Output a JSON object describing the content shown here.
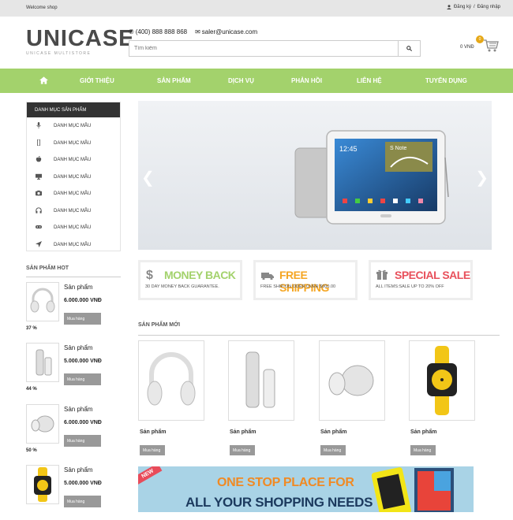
{
  "topbar": {
    "welcome": "Welcome shop",
    "register": "Đăng ký",
    "separator": "/",
    "login": "Đăng nhập"
  },
  "header": {
    "logo": "UNICASE",
    "tagline": "UNICASE MULTISTORE",
    "phone": "(400) 888 888 868",
    "email": "saler@unicase.com",
    "search_placeholder": "Tìm kiếm",
    "cart_amount": "0 VNĐ",
    "cart_count": "0"
  },
  "nav": {
    "items": [
      "GIỚI THIỆU",
      "SẢN PHẨM",
      "DỊCH VỤ",
      "PHẢN HỒI",
      "LIÊN HỆ",
      "TUYỂN DỤNG"
    ]
  },
  "sidebar": {
    "title": "DANH MỤC SẢN PHẨM",
    "categories": [
      {
        "label": "DANH MỤC MẪU",
        "icon": "microphone-icon"
      },
      {
        "label": "DANH MỤC MẪU",
        "icon": "mobile-icon"
      },
      {
        "label": "DANH MỤC MẪU",
        "icon": "apple-icon"
      },
      {
        "label": "DANH MỤC MẪU",
        "icon": "monitor-icon"
      },
      {
        "label": "DANH MỤC MẪU",
        "icon": "camera-icon"
      },
      {
        "label": "DANH MỤC MẪU",
        "icon": "headphones-icon"
      },
      {
        "label": "DANH MỤC MẪU",
        "icon": "gamepad-icon"
      },
      {
        "label": "DANH MỤC MẪU",
        "icon": "location-arrow-icon"
      }
    ]
  },
  "hot": {
    "title": "SẢN PHẨM HOT",
    "items": [
      {
        "name": "Sản phẩm",
        "price": "6.000.000 VNĐ",
        "buy": "Mua hàng",
        "percent": "37 %"
      },
      {
        "name": "Sản phẩm",
        "price": "5.000.000 VNĐ",
        "buy": "Mua hàng",
        "percent": "44 %"
      },
      {
        "name": "Sản phẩm",
        "price": "6.000.000 VNĐ",
        "buy": "Mua hàng",
        "percent": "50 %"
      },
      {
        "name": "Sản phẩm",
        "price": "5.000.000 VNĐ",
        "buy": "Mua hàng",
        "percent": ""
      }
    ]
  },
  "tablet_screen": {
    "time": "12:45",
    "note": "S Note"
  },
  "features": [
    {
      "title": "MONEY BACK",
      "subtitle": "30 DAY MONEY BACK GUARANTEE.",
      "color": "#a3d26c",
      "icon": "dollar-icon"
    },
    {
      "title": "FREE SHIPPING",
      "subtitle": "FREE SHIP-ON ODER OVER $600.00",
      "color": "#f5a623",
      "icon": "truck-icon"
    },
    {
      "title": "SPECIAL SALE",
      "subtitle": "ALL ITEMS:SALE UP TO 20% OFF",
      "color": "#e8505b",
      "icon": "gift-icon"
    }
  ],
  "new_products": {
    "title": "SẢN PHẨM MỚI",
    "items": [
      {
        "name": "Sản phẩm",
        "buy": "Mua hàng"
      },
      {
        "name": "Sản phẩm",
        "buy": "Mua hàng"
      },
      {
        "name": "Sản phẩm",
        "buy": "Mua hàng"
      },
      {
        "name": "Sản phẩm",
        "buy": "Mua hàng"
      }
    ]
  },
  "banner": {
    "tag": "NEW",
    "line1": "ONE STOP PLACE FOR",
    "line2": "ALL YOUR SHOPPING NEEDS"
  }
}
